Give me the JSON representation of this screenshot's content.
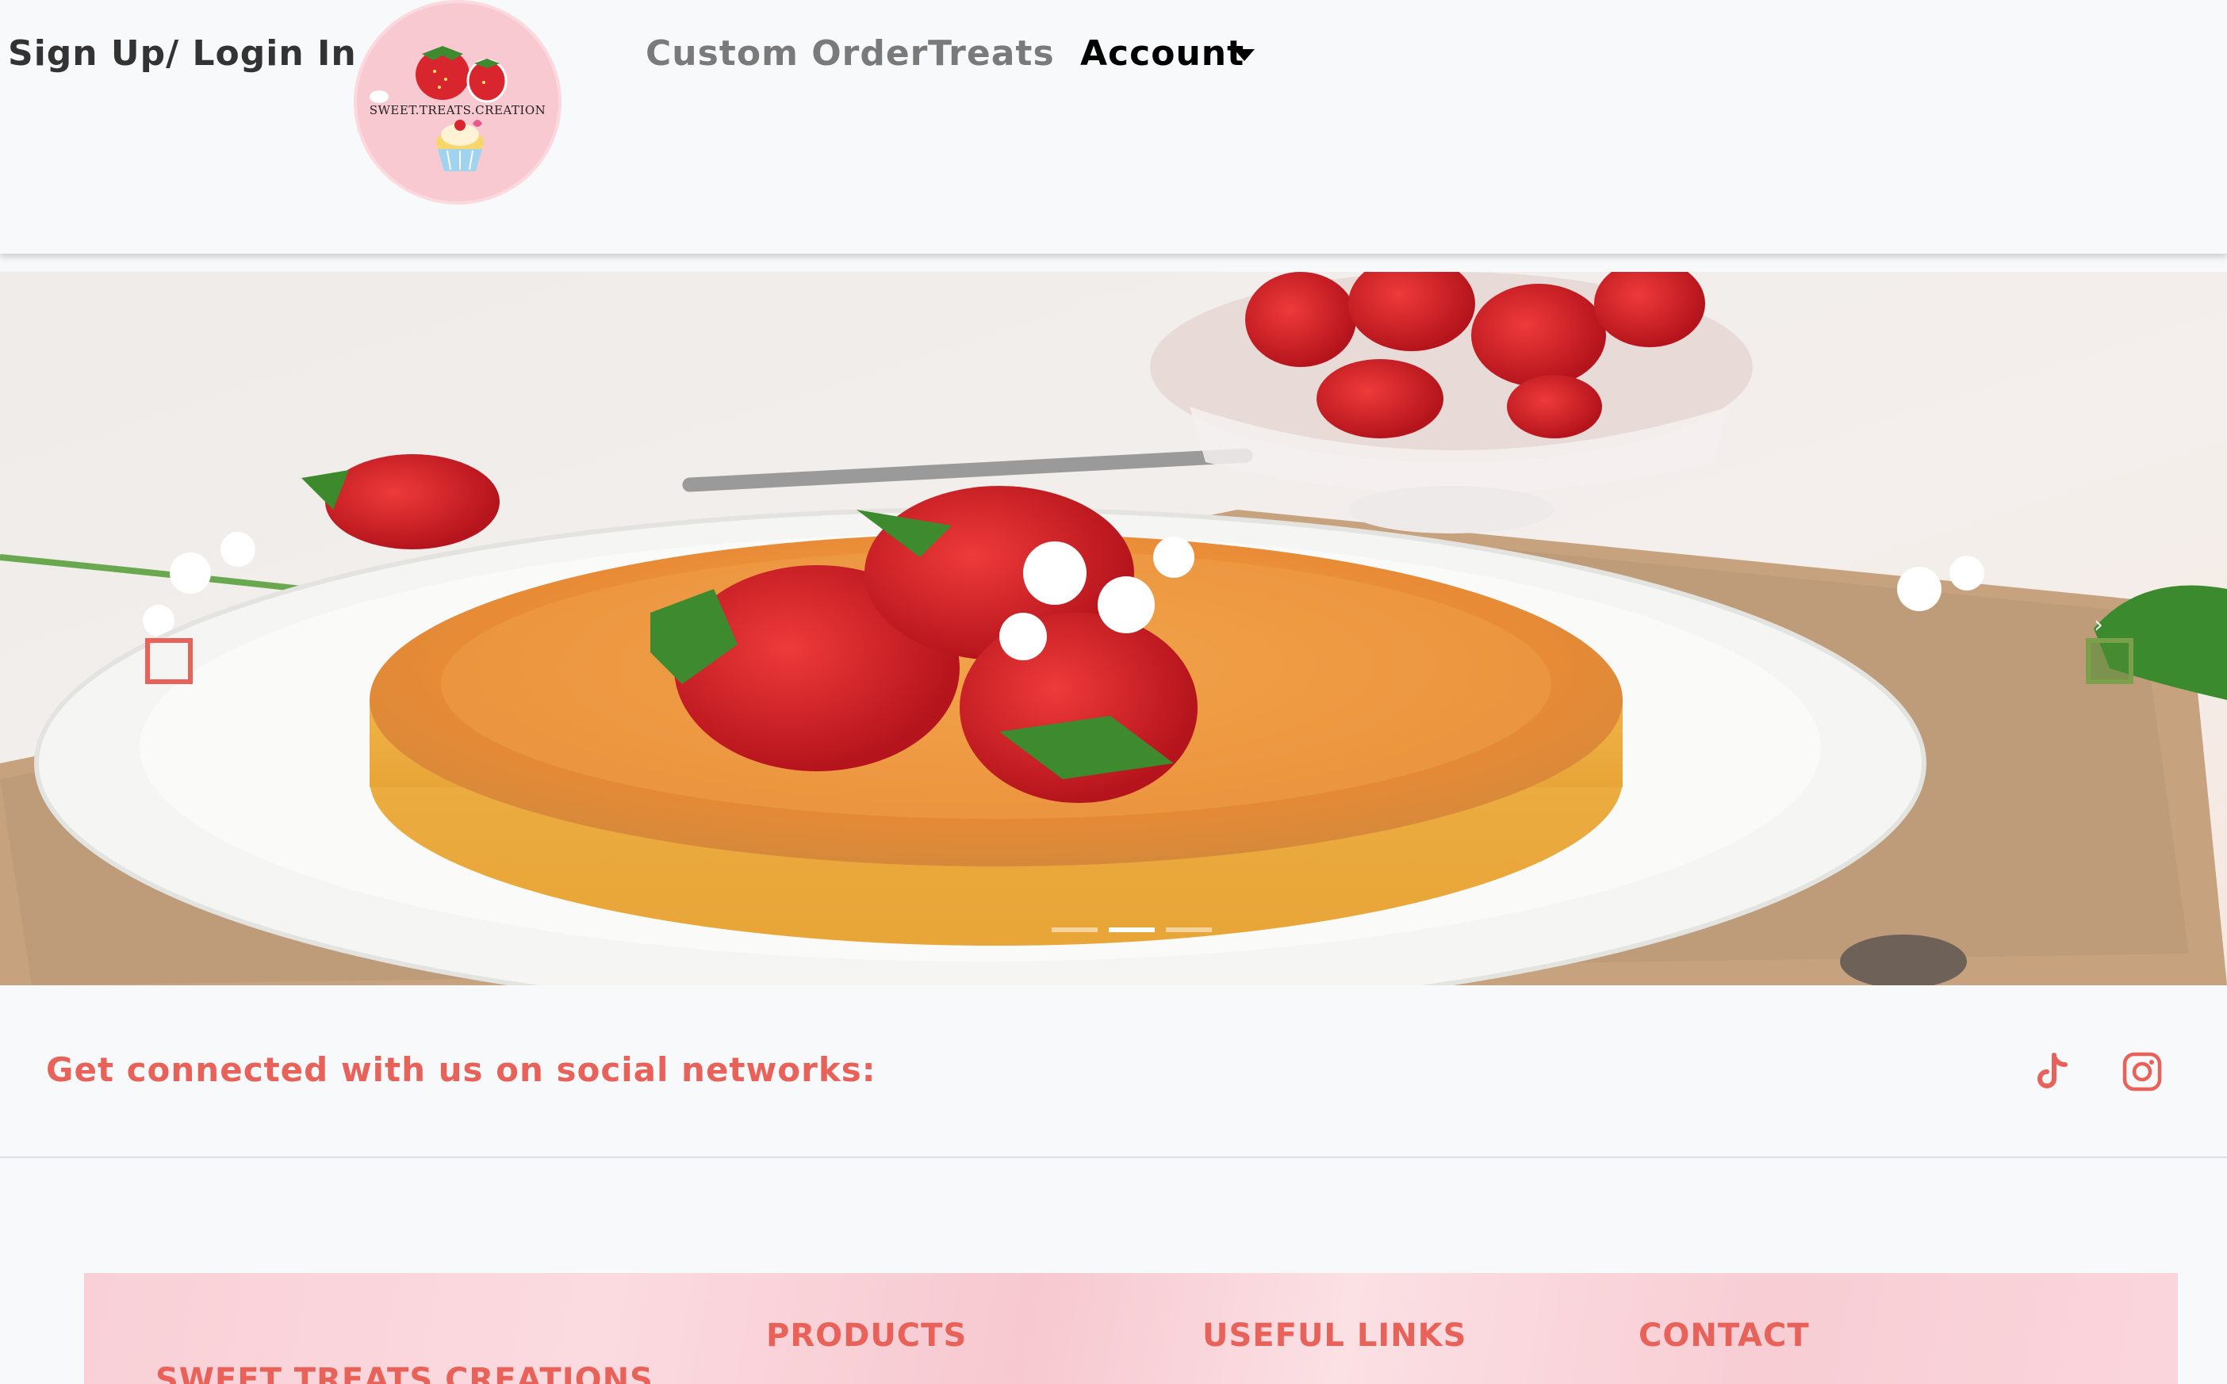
{
  "nav": {
    "signup_label": "Sign Up/ Login In",
    "custom_order_label": "Custom Order",
    "treats_label": "Treats",
    "account_label": "Account",
    "logo_text": "SWEET.TREATS.CREATION"
  },
  "carousel": {
    "slide_count": 3,
    "active_index": 1
  },
  "social": {
    "text": "Get connected with us on social networks:",
    "icons": [
      "tiktok-icon",
      "instagram-icon"
    ]
  },
  "footer": {
    "brand": "SWEET TREATS CREATIONS",
    "products_heading": "PRODUCTS",
    "useful_links_heading": "USEFUL LINKS",
    "contact_heading": "CONTACT"
  },
  "colors": {
    "accent": "#e8625a",
    "footer_pink": "#f9d0d7",
    "navbar_bg": "#f8f9fa"
  }
}
